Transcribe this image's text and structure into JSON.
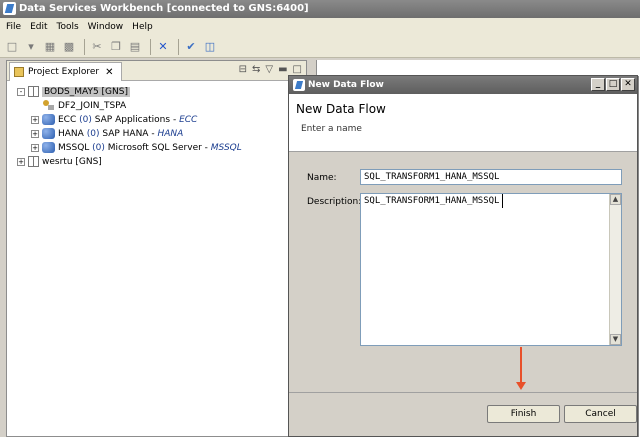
{
  "window": {
    "title": "Data Services Workbench [connected to GNS:6400]"
  },
  "menu": {
    "items": [
      "File",
      "Edit",
      "Tools",
      "Window",
      "Help"
    ]
  },
  "explorer": {
    "tab_label": "Project Explorer",
    "tree": [
      {
        "label": "BODS_MAY5 [GNS]",
        "toggle": "-",
        "icon": "project-icon",
        "selected": true
      },
      {
        "label": "DF2_JOIN_TSPA",
        "icon": "dataflow-icon"
      },
      {
        "label": "ECC",
        "count": "(0)",
        "type": "SAP Applications",
        "alias": "ECC",
        "toggle": "+",
        "icon": "datastore-icon"
      },
      {
        "label": "HANA",
        "count": "(0)",
        "type": "SAP HANA",
        "alias": "HANA",
        "toggle": "+",
        "icon": "datastore-icon"
      },
      {
        "label": "MSSQL",
        "count": "(0)",
        "type": "Microsoft SQL Server",
        "alias": "MSSQL",
        "toggle": "+",
        "icon": "datastore-icon"
      },
      {
        "label": "wesrtu [GNS]",
        "toggle": "+",
        "icon": "project-icon"
      }
    ]
  },
  "dialog": {
    "title": "New Data Flow",
    "header_title": "New Data Flow",
    "header_subtitle": "Enter a name",
    "name_label": "Name:",
    "name_value": "SQL_TRANSFORM1_HANA_MSSQL",
    "description_label": "Description:",
    "description_value": "SQL_TRANSFORM1_HANA_MSSQL",
    "finish_label": "Finish",
    "cancel_label": "Cancel"
  },
  "colors": {
    "annotation_arrow": "#e8502a",
    "titlebar": "#6e6e6e",
    "link_text": "#1b3d8f"
  }
}
